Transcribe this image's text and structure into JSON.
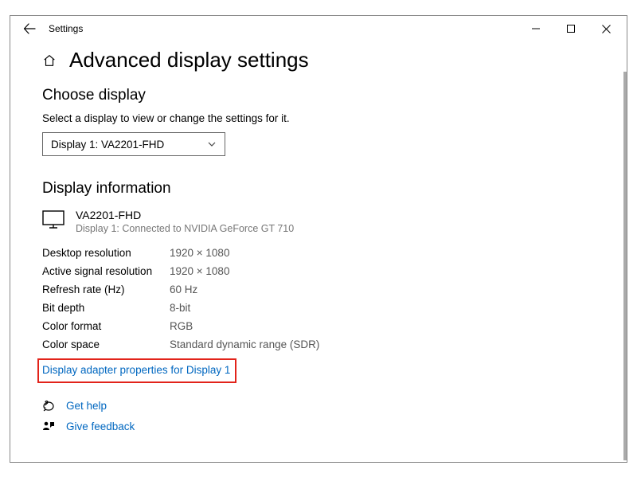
{
  "window": {
    "title": "Settings"
  },
  "page": {
    "title": "Advanced display settings"
  },
  "choose": {
    "heading": "Choose display",
    "desc": "Select a display to view or change the settings for it.",
    "selected": "Display 1: VA2201-FHD"
  },
  "info": {
    "heading": "Display information",
    "display_name": "VA2201-FHD",
    "display_sub": "Display 1: Connected to NVIDIA GeForce GT 710",
    "rows": [
      {
        "label": "Desktop resolution",
        "value": "1920 × 1080"
      },
      {
        "label": "Active signal resolution",
        "value": "1920 × 1080"
      },
      {
        "label": "Refresh rate (Hz)",
        "value": "60 Hz"
      },
      {
        "label": "Bit depth",
        "value": "8-bit"
      },
      {
        "label": "Color format",
        "value": "RGB"
      },
      {
        "label": "Color space",
        "value": "Standard dynamic range (SDR)"
      }
    ],
    "adapter_link": "Display adapter properties for Display 1"
  },
  "footer": {
    "help": "Get help",
    "feedback": "Give feedback"
  }
}
